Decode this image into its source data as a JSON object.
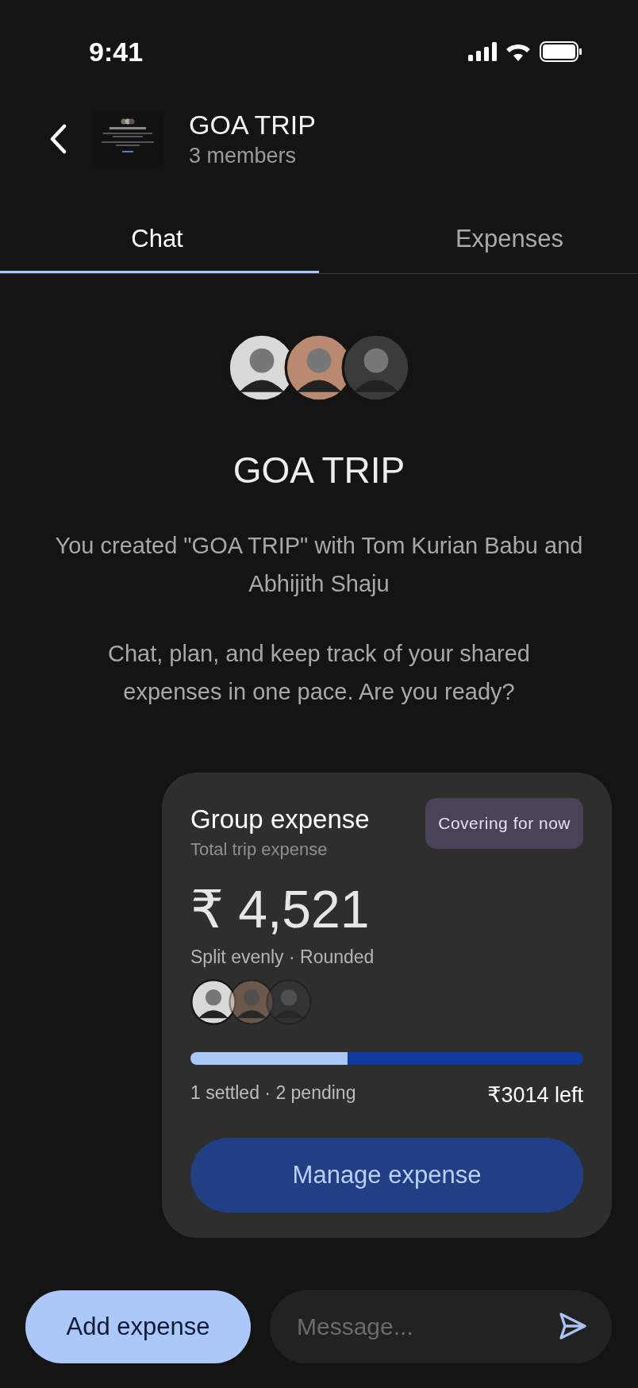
{
  "status_bar": {
    "time": "9:41"
  },
  "header": {
    "title": "GOA TRIP",
    "subtitle": "3 members"
  },
  "tabs": [
    {
      "label": "Chat",
      "selected": true
    },
    {
      "label": "Expenses",
      "selected": false
    }
  ],
  "intro": {
    "title": "GOA TRIP",
    "paragraphs": [
      "You created \"GOA TRIP\" with Tom Kurian Babu and Abhijith Shaju",
      "Chat, plan, and keep track of your shared expenses in one pace. Are you ready?"
    ]
  },
  "expense_card": {
    "title": "Group expense",
    "badge": "Covering for now",
    "subtitle": "Total trip expense",
    "amount": "₹ 4,521",
    "split": "Split evenly · Rounded",
    "members": [
      {
        "settled": true
      },
      {
        "settled": false
      },
      {
        "settled": false
      }
    ],
    "progress": {
      "level": 0.4
    },
    "status": "1 settled · 2 pending",
    "left": "₹3014 left",
    "button": "Manage expense"
  },
  "composer": {
    "add_button": "Add expense",
    "placeholder": "Message..."
  }
}
